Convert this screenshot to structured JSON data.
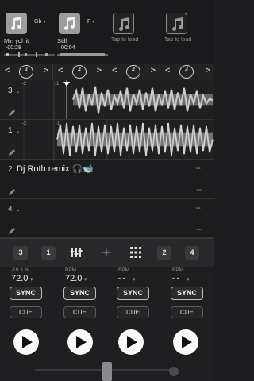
{
  "decks": [
    {
      "title": "Min yol jit",
      "time": "-00:28",
      "key": "Gb",
      "loaded": true
    },
    {
      "title": "Still",
      "time": "00:04",
      "key": "F",
      "loaded": true
    },
    {
      "title": "Tap to load",
      "time": "",
      "key": "",
      "loaded": false
    },
    {
      "title": "Tap to load",
      "time": "",
      "key": "",
      "loaded": false
    }
  ],
  "loop_bar": {
    "segments": [
      {
        "left_arrow": "<",
        "right_arrow": ">",
        "loop_size": "4"
      },
      {
        "left_arrow": "<",
        "right_arrow": ">",
        "loop_size": "4"
      },
      {
        "left_arrow": "<",
        "right_arrow": ">",
        "loop_size": "4"
      },
      {
        "left_arrow": "<",
        "right_arrow": ">",
        "loop_size": "4"
      }
    ]
  },
  "tracks": [
    {
      "number": "3",
      "beat_marks": [
        "-2",
        "-1"
      ]
    },
    {
      "number": "1",
      "beat_marks": [
        "-2",
        "-1",
        "1"
      ]
    },
    {
      "number": "2",
      "label": "Dj Roth remix 🎧🐋",
      "add": "+",
      "remove": "−"
    },
    {
      "number": "4",
      "add": "+",
      "remove": "−"
    }
  ],
  "toolbar": {
    "left_deck_a": "3",
    "left_deck_b": "1",
    "right_deck_a": "2",
    "right_deck_b": "4"
  },
  "controls": [
    {
      "caption": "-19.3 %",
      "bpm": "72.0",
      "sync": "SYNC",
      "cue": "CUE"
    },
    {
      "caption": "BPM",
      "bpm": "72.0",
      "sync": "SYNC",
      "cue": "CUE"
    },
    {
      "caption": "BPM",
      "bpm": "- -",
      "sync": "SYNC",
      "cue": "CUE"
    },
    {
      "caption": "BPM",
      "bpm": "- -",
      "sync": "SYNC",
      "cue": "CUE"
    }
  ],
  "colors": {
    "background": "#1d1d1f",
    "button_border": "#bdbdbd",
    "play": "#fafafa"
  }
}
